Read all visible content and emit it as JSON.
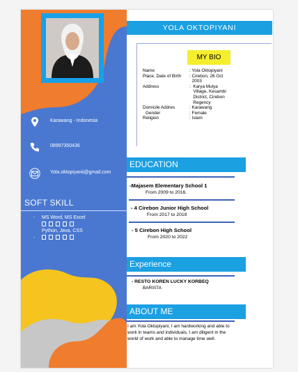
{
  "name": "YOLA OKTOPIYANI",
  "contacts": [
    {
      "icon": "location-icon",
      "text": "Karawang - Indonesia"
    },
    {
      "icon": "phone-icon",
      "text": "08997350436"
    },
    {
      "icon": "email-icon",
      "text": "Yola.oktopiyanii@gmail.com"
    }
  ],
  "soft_skill": {
    "title": "SOFT SKILL",
    "items": [
      {
        "dash": "-",
        "text": "MS Word, MS Excel"
      },
      {
        "dash": "",
        "text": "Python, Java, CSS"
      }
    ]
  },
  "bio": {
    "title": "MY BIO",
    "rows": [
      {
        "label": "Name",
        "value": ": Yola Oktopiyani"
      },
      {
        "label": "Place, Date of Birth",
        "value": ": Cirebon, 26 Oct\n  2003"
      },
      {
        "label": "Address",
        "value": ":  Karya Mulya\n   Village, Kesambi\n   District, Cirebon\n   Regency"
      },
      {
        "label": "Domicile Addres",
        "value": ": Karawang"
      },
      {
        "label": "Gender",
        "value": ": Female"
      },
      {
        "label": "Religion",
        "value": ": Islam"
      }
    ]
  },
  "education": {
    "title": "EDUCATION",
    "items": [
      {
        "school": "-Majasem Elementary School 1",
        "years": "From 2009 to 2016."
      },
      {
        "school": "- 4 Cirebon Junior High School",
        "years": "From 2017 to 2019"
      },
      {
        "school": "- 5 Cirebon High School",
        "years": "From 2020 to 2022"
      }
    ]
  },
  "experience": {
    "title": "Experience",
    "items": [
      {
        "place": "- RESTO KOREN LUCKY KORBEQ",
        "role": "BARISTA"
      }
    ]
  },
  "about": {
    "title": "ABOUT ME",
    "text": "I am Yola Oktopiyani, I am hardworking and able to work in teams and individuals, I am diligent in the world of work and able to manage time well."
  },
  "colors": {
    "sidebar": "#4a78d0",
    "header_bar": "#1ba0e2",
    "accent_orange": "#f07c2e",
    "accent_yellow": "#f5c41f",
    "accent_grey": "#c7c7c7",
    "highlight": "#f5ee2e"
  }
}
